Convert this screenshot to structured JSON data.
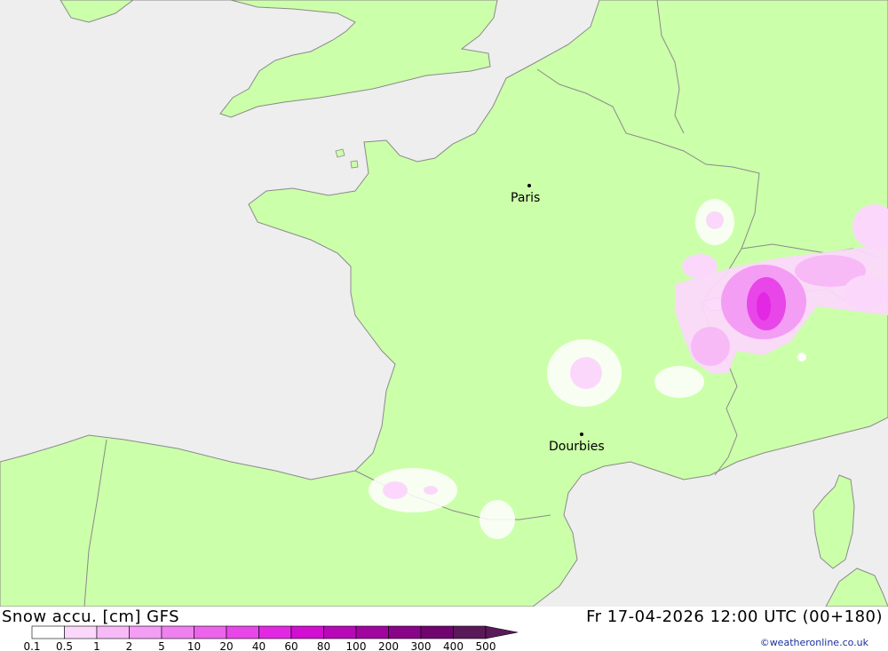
{
  "header": {
    "product": "Snow accu. [cm] GFS",
    "valid_time": "Fr 17-04-2026 12:00 UTC (00+180)"
  },
  "credit": "©weatheronline.co.uk",
  "cities": [
    {
      "name": "Paris"
    },
    {
      "name": "Dourbies"
    }
  ],
  "legend": {
    "ticks": [
      "0.1",
      "0.5",
      "1",
      "2",
      "5",
      "10",
      "20",
      "40",
      "60",
      "80",
      "100",
      "200",
      "300",
      "400",
      "500"
    ],
    "colors": [
      "#ffffff",
      "#fbd8fb",
      "#f7baf7",
      "#f49df4",
      "#f080f0",
      "#ec63ec",
      "#e846e8",
      "#e228e2",
      "#d10ed1",
      "#b808b8",
      "#a005a0",
      "#880488",
      "#700570",
      "#5a1a5a"
    ]
  },
  "colors": {
    "land": "#ccffaa",
    "sea": "#eeeeee",
    "border": "#8a8a8a"
  }
}
